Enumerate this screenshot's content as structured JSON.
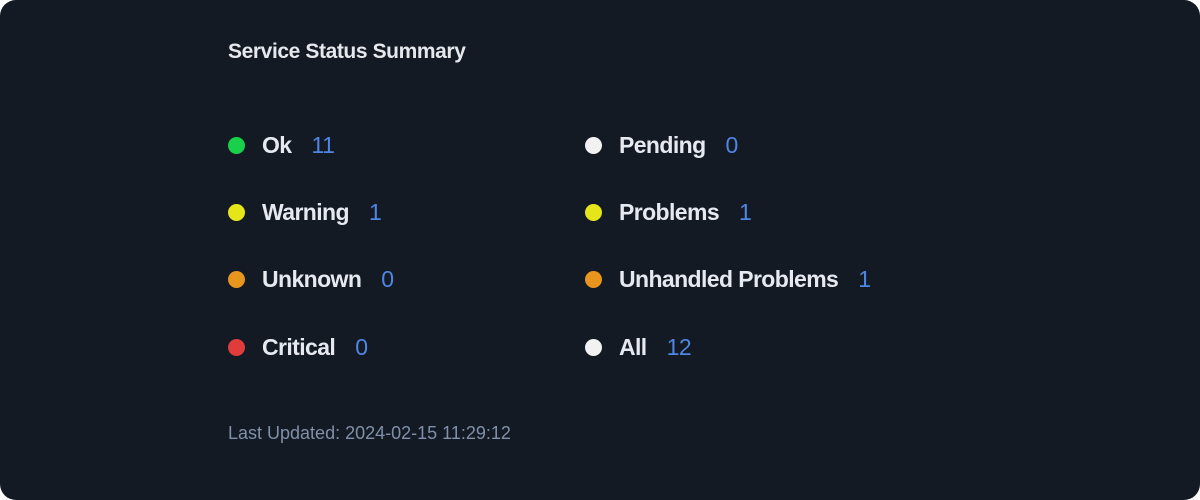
{
  "card": {
    "title": "Service Status Summary",
    "last_updated": "Last Updated: 2024-02-15 11:29:12"
  },
  "colors": {
    "background": "#131a24",
    "count_blue": "#4f86e4",
    "ok": "#18d04a",
    "warning": "#e5e51a",
    "unknown": "#e8951e",
    "critical": "#e03c3c",
    "neutral": "#f2f2f2"
  },
  "statuses": [
    {
      "label": "Ok",
      "count": "11",
      "dot": "green-dot-icon"
    },
    {
      "label": "Warning",
      "count": "1",
      "dot": "yellow-dot-icon"
    },
    {
      "label": "Unknown",
      "count": "0",
      "dot": "orange-dot-icon"
    },
    {
      "label": "Critical",
      "count": "0",
      "dot": "red-dot-icon"
    },
    {
      "label": "Pending",
      "count": "0",
      "dot": "white-dot-icon"
    },
    {
      "label": "Problems",
      "count": "1",
      "dot": "yellow-dot-icon"
    },
    {
      "label": "Unhandled Problems",
      "count": "1",
      "dot": "orange-dot-icon"
    },
    {
      "label": "All",
      "count": "12",
      "dot": "white-dot-icon"
    }
  ]
}
